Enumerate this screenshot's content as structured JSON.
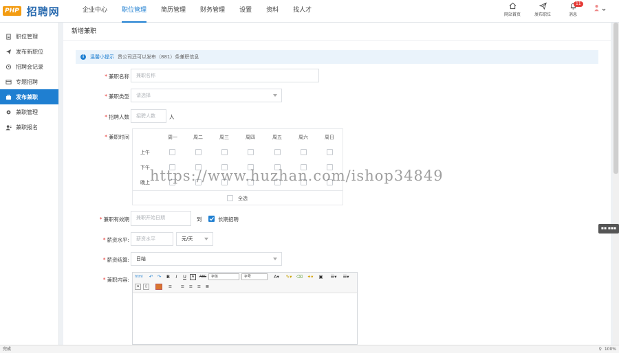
{
  "header": {
    "logo_badge": "PHP",
    "logo_text": "招聘网",
    "nav": [
      "企业中心",
      "职位管理",
      "简历管理",
      "财务管理",
      "设置",
      "资料",
      "找人才"
    ],
    "active_nav": 1,
    "icons": [
      {
        "label": "网站首页",
        "icon": "home-icon"
      },
      {
        "label": "发布职位",
        "icon": "send-icon"
      },
      {
        "label": "消息",
        "icon": "bell-icon",
        "badge": "11"
      }
    ]
  },
  "sidebar": {
    "items": [
      {
        "label": "职位管理",
        "icon": "doc-icon"
      },
      {
        "label": "发布新职位",
        "icon": "send-icon"
      },
      {
        "label": "招聘会记录",
        "icon": "record-icon"
      },
      {
        "label": "专题招聘",
        "icon": "topic-icon"
      },
      {
        "label": "发布兼职",
        "icon": "part-time-icon"
      },
      {
        "label": "兼职管理",
        "icon": "gear-icon"
      },
      {
        "label": "兼职报名",
        "icon": "user-icon"
      }
    ],
    "active": 4
  },
  "page": {
    "title": "新增兼职",
    "tip_title": "温馨小提示",
    "tip_text": "贵公司还可以发布（881）条兼职信息"
  },
  "form": {
    "name_label": "兼职名称",
    "name_placeholder": "兼职名称",
    "type_label": "兼职类型",
    "type_placeholder": "请选择",
    "count_label": "招聘人数",
    "count_placeholder": "招聘人数",
    "count_unit": "人",
    "time_label": "兼职时间",
    "days": [
      "周一",
      "周二",
      "周三",
      "周四",
      "周五",
      "周六",
      "周日"
    ],
    "periods": [
      "上午",
      "下午",
      "晚上"
    ],
    "select_all": "全选",
    "valid_label": "兼职有效期",
    "valid_placeholder": "兼职开始日期",
    "valid_to": "到",
    "long_term": "长期招聘",
    "salary_label": "薪资水平:",
    "salary_placeholder": "薪资水平",
    "salary_unit": "元/天",
    "settle_label": "薪资结算:",
    "settle_value": "日结",
    "content_label": "兼职内容:"
  },
  "editor": {
    "html_btn": "html",
    "font_family": "字体",
    "font_size": "字号"
  },
  "statusbar": {
    "left": "完成",
    "zoom": "100%"
  },
  "watermark": "https://www.huzhan.com/ishop34849",
  "mini_badge": "▪▪ ▪▪▪",
  "colors": {
    "accent": "#1f7fd1",
    "required": "#e53935",
    "logo": "#2b6cb0"
  }
}
